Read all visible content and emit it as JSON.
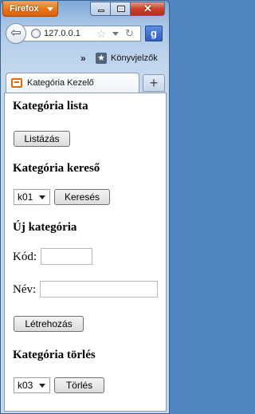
{
  "browser": {
    "app_button_label": "Firefox",
    "url": "127.0.0.1",
    "search_engine_label": "g",
    "bookmarks_chevron": "»",
    "bookmarks_label": "Könyvjelzők",
    "tab_title": "Kategória Kezelő",
    "new_tab_label": "+"
  },
  "page": {
    "list_section": {
      "heading": "Kategória lista",
      "button_label": "Listázás"
    },
    "search_section": {
      "heading": "Kategória kereső",
      "select_value": "k01",
      "button_label": "Keresés"
    },
    "new_section": {
      "heading": "Új kategória",
      "code_label": "Kód:",
      "code_value": "",
      "name_label": "Név:",
      "name_value": "",
      "button_label": "Létrehozás"
    },
    "delete_section": {
      "heading": "Kategória törlés",
      "select_value": "k03",
      "button_label": "Törlés"
    }
  }
}
